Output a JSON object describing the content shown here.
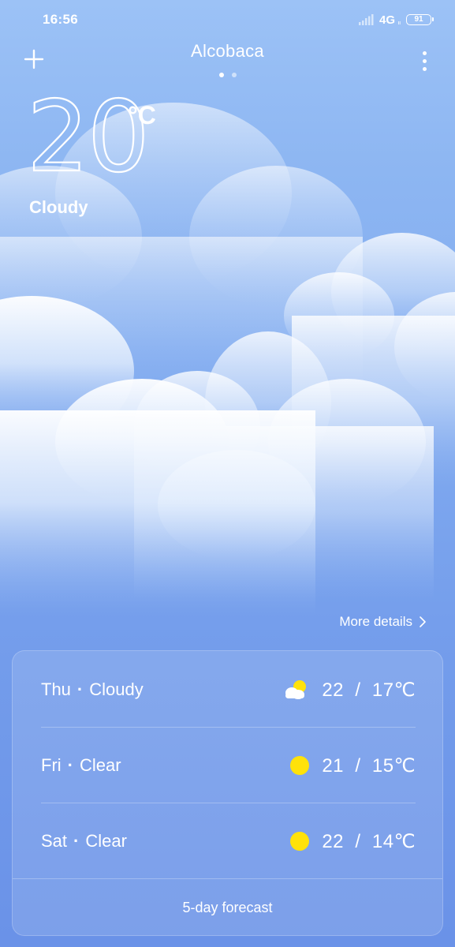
{
  "status_bar": {
    "time": "16:56",
    "network": "4G",
    "network_sub": "II",
    "battery_level": "91",
    "signal_icon": "cellular-signal-icon"
  },
  "header": {
    "city": "Alcobaca",
    "add_icon": "plus-icon",
    "menu_icon": "more-vertical-icon",
    "page_count": 2,
    "active_page": 1
  },
  "current": {
    "temperature": "20",
    "unit": "°C",
    "condition": "Cloudy"
  },
  "more_details": {
    "label": "More details",
    "icon": "chevron-right-icon"
  },
  "forecast": {
    "days": [
      {
        "day": "Thu",
        "separator": "·",
        "condition": "Cloudy",
        "icon": "partly-cloudy-icon",
        "temps": "22  /  17℃"
      },
      {
        "day": "Fri",
        "separator": "·",
        "condition": "Clear",
        "icon": "sun-icon",
        "temps": "21  /  15℃"
      },
      {
        "day": "Sat",
        "separator": "·",
        "condition": "Clear",
        "icon": "sun-icon",
        "temps": "22  /  14℃"
      }
    ],
    "five_day_label": "5-day forecast"
  },
  "colors": {
    "sky_top": "#9cc2f6",
    "sky_bottom": "#6a92e8",
    "sun": "#ffe20a"
  }
}
